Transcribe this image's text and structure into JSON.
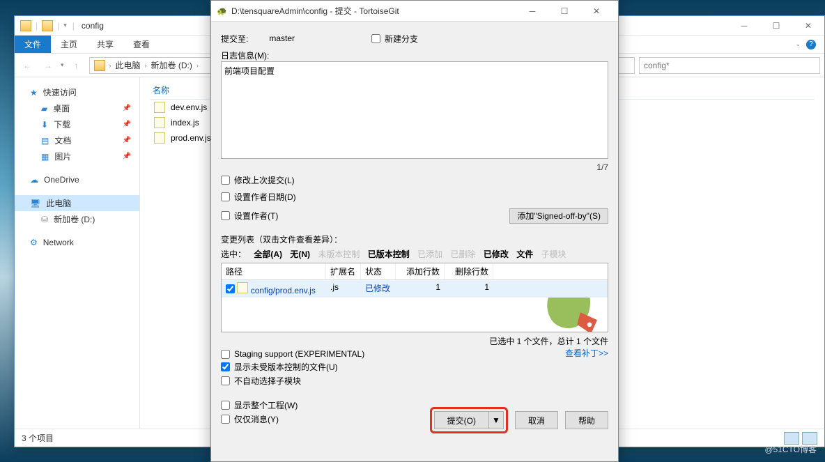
{
  "explorer": {
    "title": "config",
    "tabs": {
      "file": "文件",
      "home": "主页",
      "share": "共享",
      "view": "查看"
    },
    "breadcrumbs": [
      "此电脑",
      "新加卷 (D:)"
    ],
    "search_placeholder": "config*",
    "sidebar": {
      "quick": "快速访问",
      "desktop": "桌面",
      "downloads": "下载",
      "documents": "文档",
      "pictures": "图片",
      "onedrive": "OneDrive",
      "thispc": "此电脑",
      "volume": "新加卷 (D:)",
      "network": "Network"
    },
    "filehead": "名称",
    "files": [
      "dev.env.js",
      "index.js",
      "prod.env.js"
    ],
    "status": "3 个项目"
  },
  "dialog": {
    "title": "D:\\tensquareAdmin\\config - 提交 - TortoiseGit",
    "commit_to_label": "提交至:",
    "branch": "master",
    "new_branch": "新建分支",
    "log_label": "日志信息(M):",
    "log_text": "前端项目配置",
    "counter": "1/7",
    "amend": "修改上次提交(L)",
    "set_date": "设置作者日期(D)",
    "set_author": "设置作者(T)",
    "signed_off": "添加\"Signed-off-by\"(S)",
    "changes_label": "变更列表（双击文件查看差异）：",
    "select_label": "选中：",
    "all": "全部(A)",
    "none": "无(N)",
    "unversioned": "未版本控制",
    "versioned": "已版本控制",
    "added": "已添加",
    "deleted": "已删除",
    "modified": "已修改",
    "files_t": "文件",
    "submod": "子模块",
    "cols": {
      "path": "路径",
      "ext": "扩展名",
      "status": "状态",
      "add": "添加行数",
      "del": "删除行数"
    },
    "row": {
      "path": "config/prod.env.js",
      "ext": ".js",
      "status": "已修改",
      "add": "1",
      "del": "1"
    },
    "summary": "已选中 1 个文件，总计 1 个文件",
    "staging": "Staging support (EXPERIMENTAL)",
    "show_unv": "显示未受版本控制的文件(U)",
    "no_auto_sub": "不自动选择子模块",
    "show_whole": "显示整个工程(W)",
    "msg_only": "仅仅消息(Y)",
    "view_patch": "查看补丁>>",
    "commit": "提交(O)",
    "cancel": "取消",
    "help": "帮助"
  },
  "watermark": "@51CTO博客"
}
